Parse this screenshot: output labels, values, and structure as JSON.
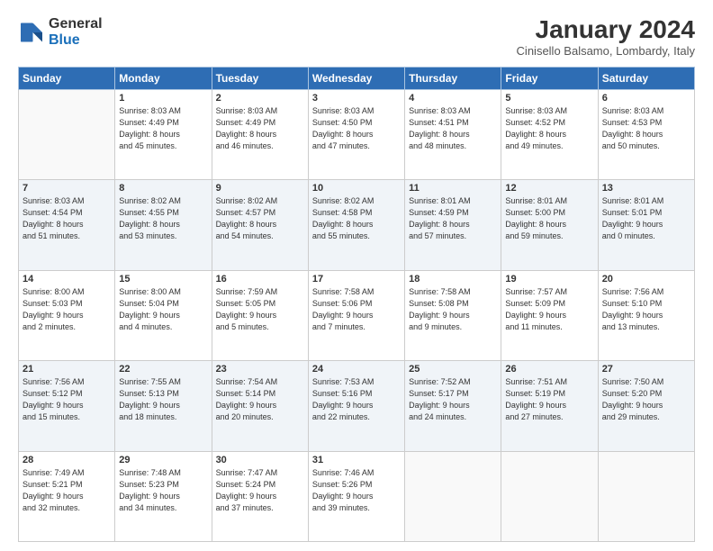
{
  "header": {
    "logo_line1": "General",
    "logo_line2": "Blue",
    "month": "January 2024",
    "location": "Cinisello Balsamo, Lombardy, Italy"
  },
  "weekdays": [
    "Sunday",
    "Monday",
    "Tuesday",
    "Wednesday",
    "Thursday",
    "Friday",
    "Saturday"
  ],
  "weeks": [
    [
      {
        "day": "",
        "info": ""
      },
      {
        "day": "1",
        "info": "Sunrise: 8:03 AM\nSunset: 4:49 PM\nDaylight: 8 hours\nand 45 minutes."
      },
      {
        "day": "2",
        "info": "Sunrise: 8:03 AM\nSunset: 4:49 PM\nDaylight: 8 hours\nand 46 minutes."
      },
      {
        "day": "3",
        "info": "Sunrise: 8:03 AM\nSunset: 4:50 PM\nDaylight: 8 hours\nand 47 minutes."
      },
      {
        "day": "4",
        "info": "Sunrise: 8:03 AM\nSunset: 4:51 PM\nDaylight: 8 hours\nand 48 minutes."
      },
      {
        "day": "5",
        "info": "Sunrise: 8:03 AM\nSunset: 4:52 PM\nDaylight: 8 hours\nand 49 minutes."
      },
      {
        "day": "6",
        "info": "Sunrise: 8:03 AM\nSunset: 4:53 PM\nDaylight: 8 hours\nand 50 minutes."
      }
    ],
    [
      {
        "day": "7",
        "info": "Sunrise: 8:03 AM\nSunset: 4:54 PM\nDaylight: 8 hours\nand 51 minutes."
      },
      {
        "day": "8",
        "info": "Sunrise: 8:02 AM\nSunset: 4:55 PM\nDaylight: 8 hours\nand 53 minutes."
      },
      {
        "day": "9",
        "info": "Sunrise: 8:02 AM\nSunset: 4:57 PM\nDaylight: 8 hours\nand 54 minutes."
      },
      {
        "day": "10",
        "info": "Sunrise: 8:02 AM\nSunset: 4:58 PM\nDaylight: 8 hours\nand 55 minutes."
      },
      {
        "day": "11",
        "info": "Sunrise: 8:01 AM\nSunset: 4:59 PM\nDaylight: 8 hours\nand 57 minutes."
      },
      {
        "day": "12",
        "info": "Sunrise: 8:01 AM\nSunset: 5:00 PM\nDaylight: 8 hours\nand 59 minutes."
      },
      {
        "day": "13",
        "info": "Sunrise: 8:01 AM\nSunset: 5:01 PM\nDaylight: 9 hours\nand 0 minutes."
      }
    ],
    [
      {
        "day": "14",
        "info": "Sunrise: 8:00 AM\nSunset: 5:03 PM\nDaylight: 9 hours\nand 2 minutes."
      },
      {
        "day": "15",
        "info": "Sunrise: 8:00 AM\nSunset: 5:04 PM\nDaylight: 9 hours\nand 4 minutes."
      },
      {
        "day": "16",
        "info": "Sunrise: 7:59 AM\nSunset: 5:05 PM\nDaylight: 9 hours\nand 5 minutes."
      },
      {
        "day": "17",
        "info": "Sunrise: 7:58 AM\nSunset: 5:06 PM\nDaylight: 9 hours\nand 7 minutes."
      },
      {
        "day": "18",
        "info": "Sunrise: 7:58 AM\nSunset: 5:08 PM\nDaylight: 9 hours\nand 9 minutes."
      },
      {
        "day": "19",
        "info": "Sunrise: 7:57 AM\nSunset: 5:09 PM\nDaylight: 9 hours\nand 11 minutes."
      },
      {
        "day": "20",
        "info": "Sunrise: 7:56 AM\nSunset: 5:10 PM\nDaylight: 9 hours\nand 13 minutes."
      }
    ],
    [
      {
        "day": "21",
        "info": "Sunrise: 7:56 AM\nSunset: 5:12 PM\nDaylight: 9 hours\nand 15 minutes."
      },
      {
        "day": "22",
        "info": "Sunrise: 7:55 AM\nSunset: 5:13 PM\nDaylight: 9 hours\nand 18 minutes."
      },
      {
        "day": "23",
        "info": "Sunrise: 7:54 AM\nSunset: 5:14 PM\nDaylight: 9 hours\nand 20 minutes."
      },
      {
        "day": "24",
        "info": "Sunrise: 7:53 AM\nSunset: 5:16 PM\nDaylight: 9 hours\nand 22 minutes."
      },
      {
        "day": "25",
        "info": "Sunrise: 7:52 AM\nSunset: 5:17 PM\nDaylight: 9 hours\nand 24 minutes."
      },
      {
        "day": "26",
        "info": "Sunrise: 7:51 AM\nSunset: 5:19 PM\nDaylight: 9 hours\nand 27 minutes."
      },
      {
        "day": "27",
        "info": "Sunrise: 7:50 AM\nSunset: 5:20 PM\nDaylight: 9 hours\nand 29 minutes."
      }
    ],
    [
      {
        "day": "28",
        "info": "Sunrise: 7:49 AM\nSunset: 5:21 PM\nDaylight: 9 hours\nand 32 minutes."
      },
      {
        "day": "29",
        "info": "Sunrise: 7:48 AM\nSunset: 5:23 PM\nDaylight: 9 hours\nand 34 minutes."
      },
      {
        "day": "30",
        "info": "Sunrise: 7:47 AM\nSunset: 5:24 PM\nDaylight: 9 hours\nand 37 minutes."
      },
      {
        "day": "31",
        "info": "Sunrise: 7:46 AM\nSunset: 5:26 PM\nDaylight: 9 hours\nand 39 minutes."
      },
      {
        "day": "",
        "info": ""
      },
      {
        "day": "",
        "info": ""
      },
      {
        "day": "",
        "info": ""
      }
    ]
  ]
}
